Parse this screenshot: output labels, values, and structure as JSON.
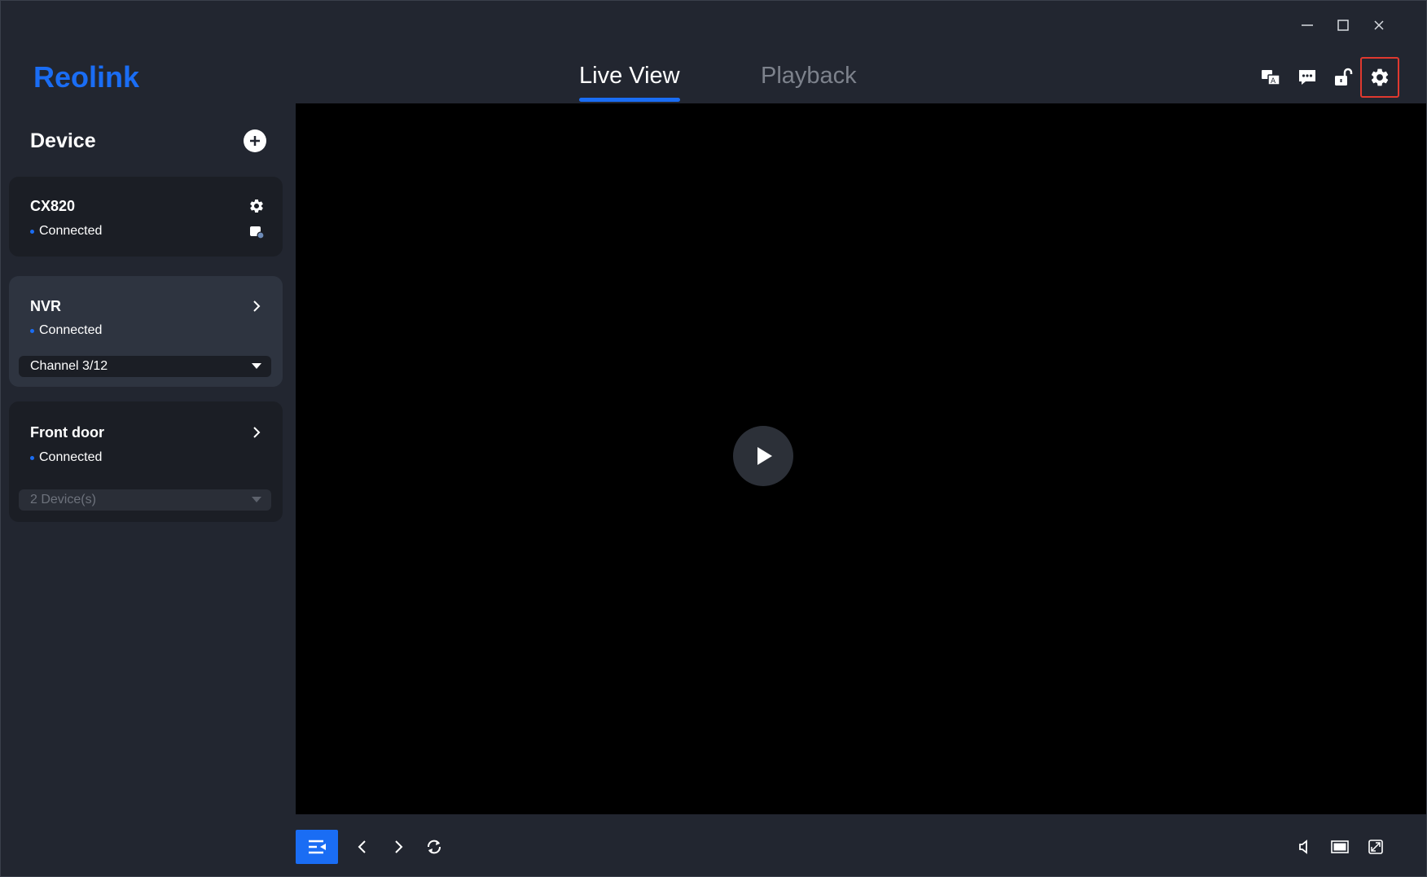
{
  "app": {
    "brand": "Reolink",
    "accent_color": "#1a6df4",
    "selection_color": "#e0392f"
  },
  "window_controls": [
    {
      "name": "minimize-button",
      "icon": "minimize-icon"
    },
    {
      "name": "maximize-button",
      "icon": "maximize-icon"
    },
    {
      "name": "close-button",
      "icon": "close-icon"
    }
  ],
  "header": {
    "tabs": [
      {
        "label": "Live View",
        "active": true
      },
      {
        "label": "Playback",
        "active": false
      }
    ],
    "icons": [
      {
        "name": "language-icon"
      },
      {
        "name": "feedback-icon"
      },
      {
        "name": "unlock-icon"
      },
      {
        "name": "settings-icon",
        "selected": true
      }
    ]
  },
  "sidebar": {
    "title": "Device",
    "add_icon": "plus-circle-icon",
    "devices": [
      {
        "name": "CX820",
        "status": "Connected",
        "icons": [
          "gear-icon",
          "storage-icon"
        ]
      },
      {
        "name": "NVR",
        "status": "Connected",
        "icons": [
          "chevron-right-icon"
        ],
        "dropdown": "Channel 3/12"
      },
      {
        "name": "Front door",
        "status": "Connected",
        "icons": [
          "chevron-right-icon"
        ],
        "dropdown": "2 Device(s)"
      }
    ]
  },
  "video": {
    "play_icon": "play-icon"
  },
  "toolbar": {
    "left": [
      "device-list-toggle-icon",
      "chevron-left-icon",
      "chevron-right-icon",
      "refresh-icon"
    ],
    "right": [
      "volume-icon",
      "single-view-icon",
      "fullscreen-icon"
    ]
  }
}
